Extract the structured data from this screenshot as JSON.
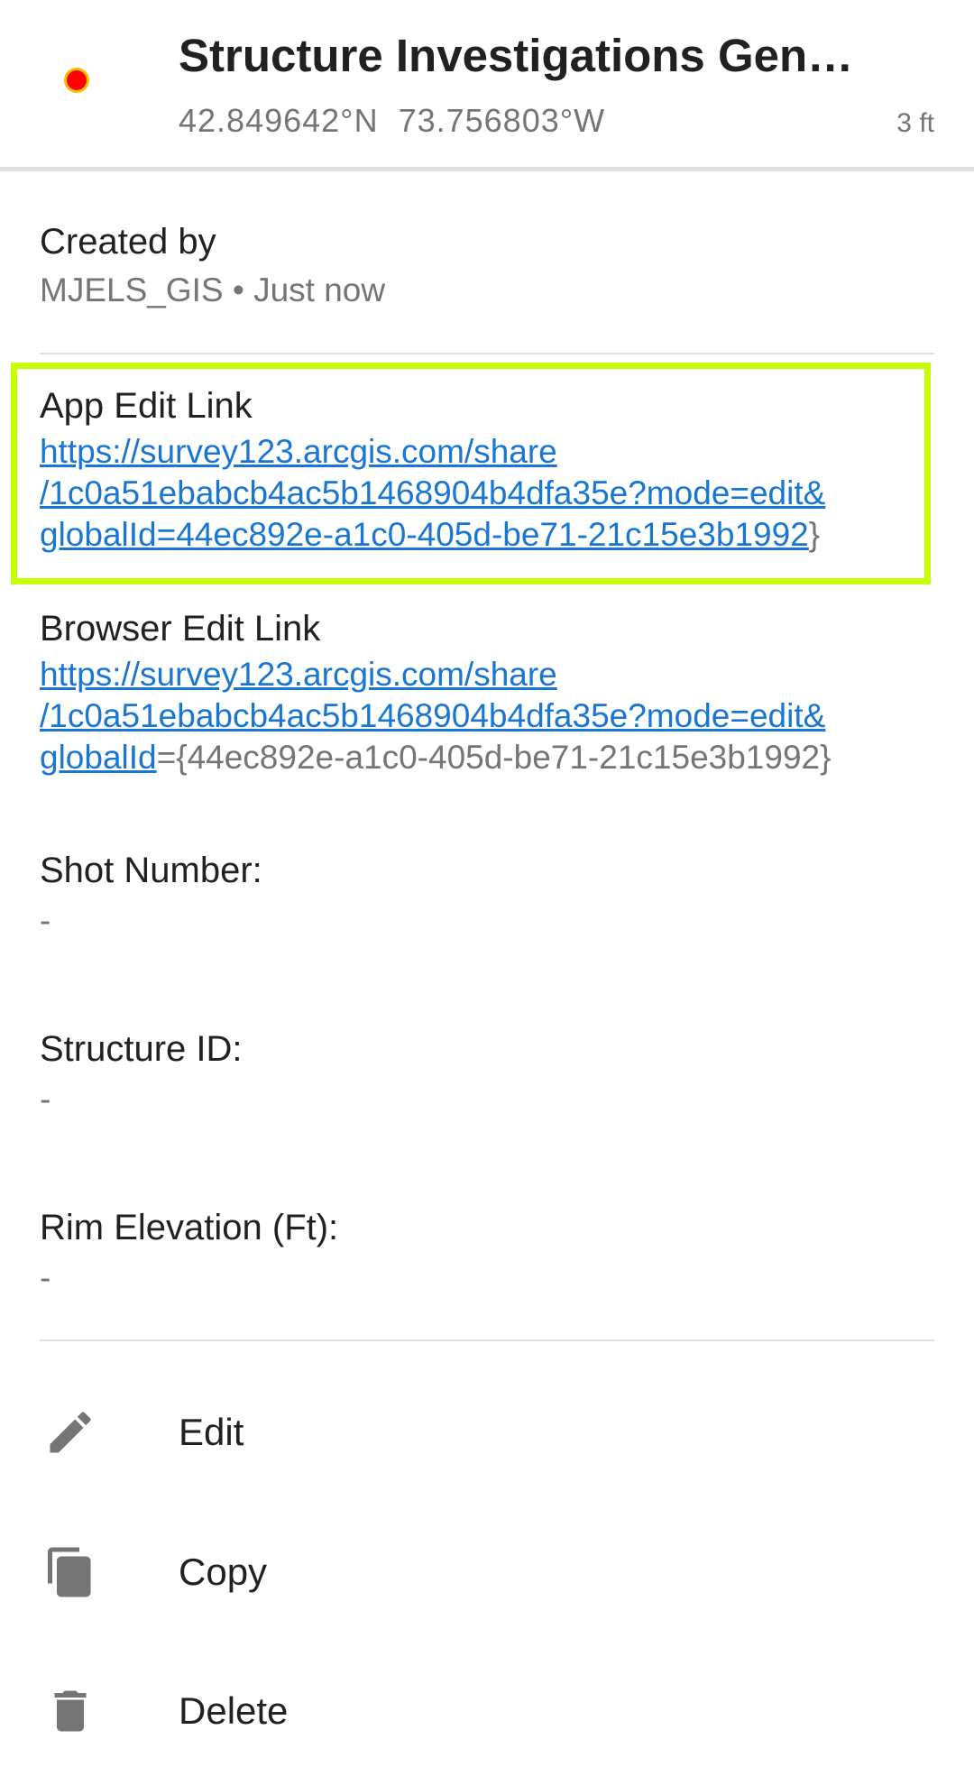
{
  "header": {
    "title": "Structure Investigations Gen…",
    "coordinates": "42.849642°N  73.756803°W",
    "elevation": "3 ft",
    "marker_color": "#ff0000"
  },
  "created": {
    "label": "Created by",
    "value": "MJELS_GIS • Just now"
  },
  "app_edit": {
    "label": "App Edit Link",
    "link_line1": "https://survey123.arcgis.com/share",
    "link_line2": "/1c0a51ebabcb4ac5b1468904b4dfa35e?mode=edit&",
    "link_line3": "globalId=44ec892e-a1c0-405d-be71-21c15e3b1992",
    "trailing": "}",
    "highlight_color": "#c6ff00"
  },
  "browser_edit": {
    "label": "Browser Edit Link",
    "link_line1": "https://survey123.arcgis.com/share",
    "link_line2": "/1c0a51ebabcb4ac5b1468904b4dfa35e?mode=edit&",
    "link_line3": "globalId",
    "trailing": "={44ec892e-a1c0-405d-be71-21c15e3b1992}"
  },
  "fields": [
    {
      "label": "Shot Number:",
      "value": "-"
    },
    {
      "label": "Structure ID:",
      "value": "-"
    },
    {
      "label": "Rim Elevation (Ft):",
      "value": "-"
    }
  ],
  "actions": [
    {
      "label": "Edit",
      "icon": "pencil-icon"
    },
    {
      "label": "Copy",
      "icon": "copy-icon"
    },
    {
      "label": "Delete",
      "icon": "trash-icon"
    }
  ]
}
